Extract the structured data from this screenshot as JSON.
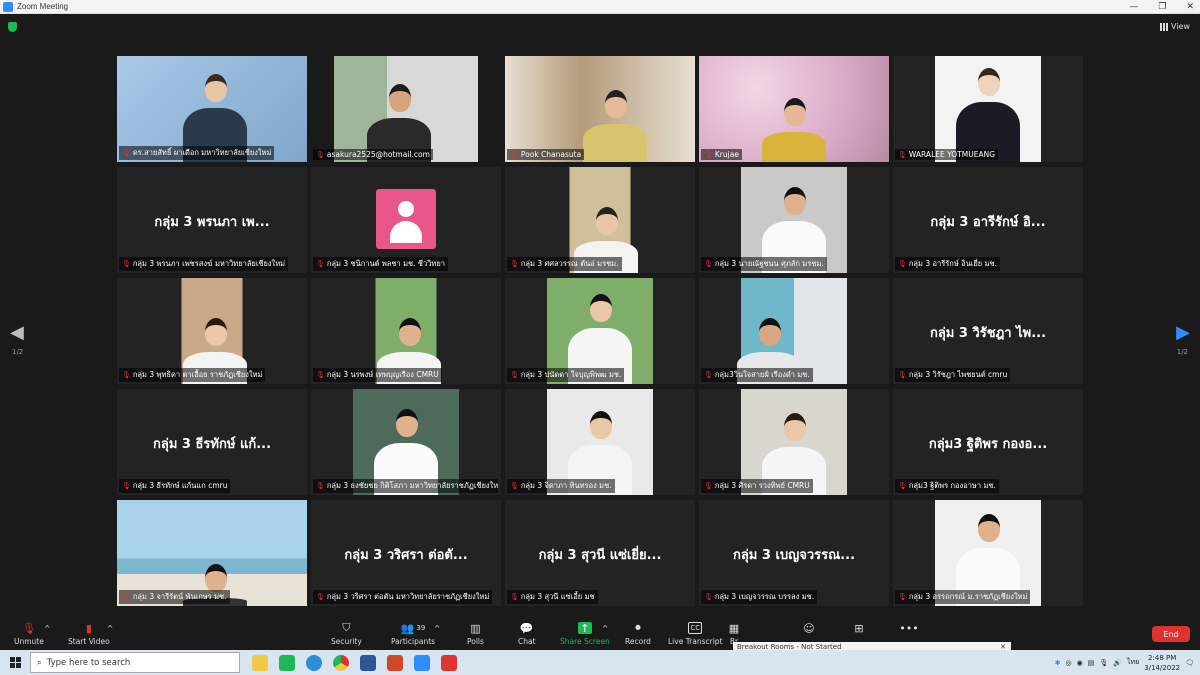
{
  "window": {
    "title": "Zoom Meeting",
    "controls": [
      "—",
      "❐",
      "✕"
    ]
  },
  "view_label": "View",
  "pagination": {
    "left": "1/2",
    "right": "1/2"
  },
  "participants_grid": [
    {
      "name": "ดร.สายสัทธิ์ ผาเดือก มหาวิทยาลัยเชียงใหม่",
      "big": "",
      "video": "edu",
      "active": false
    },
    {
      "name": "asakura2525@hotmail.com",
      "big": "",
      "video": "man",
      "active": false
    },
    {
      "name": "Pook Chanasuta",
      "big": "",
      "video": "shelf",
      "active": false
    },
    {
      "name": "Krujae",
      "big": "",
      "video": "blossom",
      "active": true
    },
    {
      "name": "WARALEE YOTMUEANG",
      "big": "",
      "video": "portrait-w",
      "active": false
    },
    {
      "name": "กลุ่ม 3 พรนภา เพชรสงฆ์ มหาวิทยาลัยเชียงใหม่",
      "big": "กลุ่ม 3 พรนภา เพ...",
      "video": "",
      "active": false
    },
    {
      "name": "กลุ่ม 3 ชนิกานต์ พลชา มช. ชีววิทยา",
      "big": "",
      "video": "avatar",
      "active": false
    },
    {
      "name": "กลุ่ม 3 ศศลวรรณ ตันอ่ มรชม.",
      "big": "",
      "video": "small-girl",
      "active": false
    },
    {
      "name": "กลุ่ม 3 นายณัฐชนน ศุภลัก มรชม.",
      "big": "",
      "video": "student-m",
      "active": false
    },
    {
      "name": "กลุ่ม 3 อารีรักษ์ อินเยี่ย มช.",
      "big": "กลุ่ม 3 อารีรักษ์ อิ...",
      "video": "",
      "active": false
    },
    {
      "name": "กลุ่ม 3 พุทธิดา ตาเอื้อย ราชภัฏเชียงใหม่",
      "big": "",
      "video": "small-room",
      "active": false
    },
    {
      "name": "กลุ่ม 3 นรพงษ์ เทพบุญเรือง CMRU",
      "big": "",
      "video": "small-green",
      "active": false
    },
    {
      "name": "กลุ่ม 3 ปนัดดา ใจบุญพิพฒ มช.",
      "big": "",
      "video": "girl-uni",
      "active": false
    },
    {
      "name": "กลุ่ม3วินใจสายฝ์ เรืองดำ มช.",
      "big": "",
      "video": "curtain",
      "active": false
    },
    {
      "name": "กลุ่ม 3 วิรัชฎา ไพชยนต์ cmru",
      "big": "กลุ่ม 3 วิรัชฎา ไพ...",
      "video": "",
      "active": false
    },
    {
      "name": "กลุ่ม 3 ธีรทักษ์ แก้นแก cmru",
      "big": "กลุ่ม 3 ธีรทักษ์ แก้...",
      "video": "",
      "active": false
    },
    {
      "name": "กลุ่ม 3 ธงชัยชย กิติโสภา มหาวิทยาลัยราชภัฏเชียงใหม่",
      "big": "",
      "video": "boy-uni",
      "active": false
    },
    {
      "name": "กลุ่ม 3 จิดาภา ทินทรอง มช.",
      "big": "",
      "video": "girl-white",
      "active": false
    },
    {
      "name": "กลุ่ม 3 ศิรดา รวงทิพย์ CMRU",
      "big": "",
      "video": "girl-outdoor",
      "active": false
    },
    {
      "name": "กลุ่ม3 ฐิติพร กองอาษา มช.",
      "big": "กลุ่ม3 ฐิติพร กองอ...",
      "video": "",
      "active": false
    },
    {
      "name": "กลุ่ม 3 จารีรัตน์ พันเกษร มช.",
      "big": "",
      "video": "beach",
      "active": false
    },
    {
      "name": "กลุ่ม 3 วริศรา ต่อตัน มหาวิทยาลัยราชภัฏเชียงใหม่",
      "big": "กลุ่ม 3 วริศรา ต่อตั...",
      "video": "",
      "active": false
    },
    {
      "name": "กลุ่ม 3 สุวนี แซ่เอี้ย มช",
      "big": "กลุ่ม 3 สุวนี แซ่เยี่ย...",
      "video": "",
      "active": false
    },
    {
      "name": "กลุ่ม 3 เบญจวรรณ บรรลง มช.",
      "big": "กลุ่ม 3 เบญจวรรณ...",
      "video": "",
      "active": false
    },
    {
      "name": "กลุ่ม 3 อรรถกรณ์ ม.ราชภัฏเชียงใหม่",
      "big": "",
      "video": "boy-white",
      "active": false
    }
  ],
  "toolbar": {
    "unmute": "Unmute",
    "start_video": "Start Video",
    "security": "Security",
    "participants": "Participants",
    "participants_count": "39",
    "polls": "Polls",
    "chat": "Chat",
    "share_screen": "Share Screen",
    "record": "Record",
    "live_transcript": "Live Transcript",
    "breakout_short": "Br",
    "end": "End"
  },
  "breakout_popup": "Breakout Rooms - Not Started",
  "taskbar": {
    "search_placeholder": "Type here to search",
    "lang": "ไทย",
    "time": "2:48 PM",
    "date": "3/14/2022"
  },
  "colors": {
    "active_border": "#c9d23a",
    "end": "#e0322f",
    "share": "#1db954",
    "zoom_blue": "#2d8cff"
  }
}
